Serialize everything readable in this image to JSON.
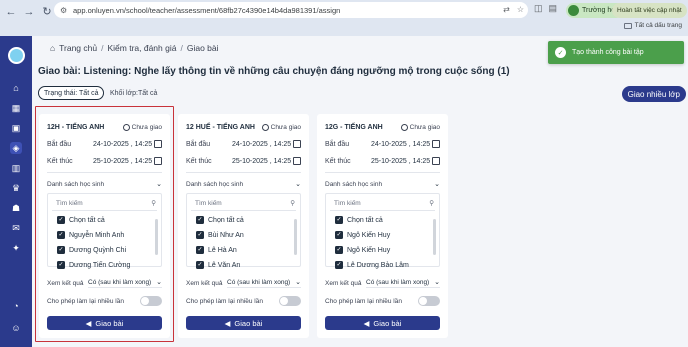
{
  "browser": {
    "url": "app.onluyen.vn/school/teacher/assessment/68fb27c4390e14b4da981391/assign",
    "profile_label": "Trường học",
    "update_label": "Hoàn tất việc cập nhật",
    "bookmarks_label": "Tất cả dấu trang"
  },
  "breadcrumb": [
    "Trang chủ",
    "Kiểm tra, đánh giá",
    "Giao bài"
  ],
  "toast": {
    "message": "Tạo thành công bài tập"
  },
  "page_title": "Giao bài: Listening: Nghe lấy thông tin về những câu chuyện đáng ngưỡng mộ trong cuộc sống (1)",
  "filters": {
    "status": "Trạng thái: Tất cả",
    "grade": "Khối lớp:Tất cả"
  },
  "assign_many_label": "Giao nhiều lớp",
  "cards": [
    {
      "name": "12H - TIẾNG ANH",
      "status": "Chưa giao",
      "start_label": "Bắt đầu",
      "start_value": "24-10-2025 , 14:25",
      "end_label": "Kết thúc",
      "end_value": "25-10-2025 , 14:25",
      "student_list_label": "Danh sách học sinh",
      "search_placeholder": "Tìm kiếm",
      "select_all": "Chọn tất cả",
      "students": [
        "Nguyễn Minh Anh",
        "Dương Quỳnh Chi",
        "Dương Tiến Cường"
      ],
      "result_label": "Xem kết quả",
      "result_value": "Có (sau khi làm xong)",
      "retry_label": "Cho phép làm lại nhiều lần",
      "retry_enabled": false,
      "assign_label": "Giao bài"
    },
    {
      "name": "12 HUẾ - TIẾNG ANH",
      "status": "Chưa giao",
      "start_label": "Bắt đầu",
      "start_value": "24-10-2025 , 14:25",
      "end_label": "Kết thúc",
      "end_value": "25-10-2025 , 14:25",
      "student_list_label": "Danh sách học sinh",
      "search_placeholder": "Tìm kiếm",
      "select_all": "Chọn tất cả",
      "students": [
        "Bùi Như An",
        "Lê Hà An",
        "Lê Văn An"
      ],
      "result_label": "Xem kết quả",
      "result_value": "Có (sau khi làm xong)",
      "retry_label": "Cho phép làm lại nhiều lần",
      "retry_enabled": false,
      "assign_label": "Giao bài"
    },
    {
      "name": "12G - TIẾNG ANH",
      "status": "Chưa giao",
      "start_label": "Bắt đầu",
      "start_value": "24-10-2025 , 14:25",
      "end_label": "Kết thúc",
      "end_value": "25-10-2025 , 14:25",
      "student_list_label": "Danh sách học sinh",
      "search_placeholder": "Tìm kiếm",
      "select_all": "Chọn tất cả",
      "students": [
        "Ngô Kiến Huy",
        "Ngô Kiến Huy",
        "Lê Dương Bảo Lâm"
      ],
      "result_label": "Xem kết quả",
      "result_value": "Có (sau khi làm xong)",
      "retry_label": "Cho phép làm lại nhiều lần",
      "retry_enabled": false,
      "assign_label": "Giao bài"
    }
  ],
  "colors": {
    "primary": "#2b3a8c",
    "toast": "#4b9f4b",
    "highlight": "#c8323a"
  },
  "sidebar_icons": [
    "home-icon",
    "calendar-icon",
    "briefcase-icon",
    "book-icon",
    "chart-icon",
    "trophy-icon",
    "users-icon",
    "chat-icon",
    "sparkle-icon",
    "pie-icon",
    "settings-icon"
  ]
}
